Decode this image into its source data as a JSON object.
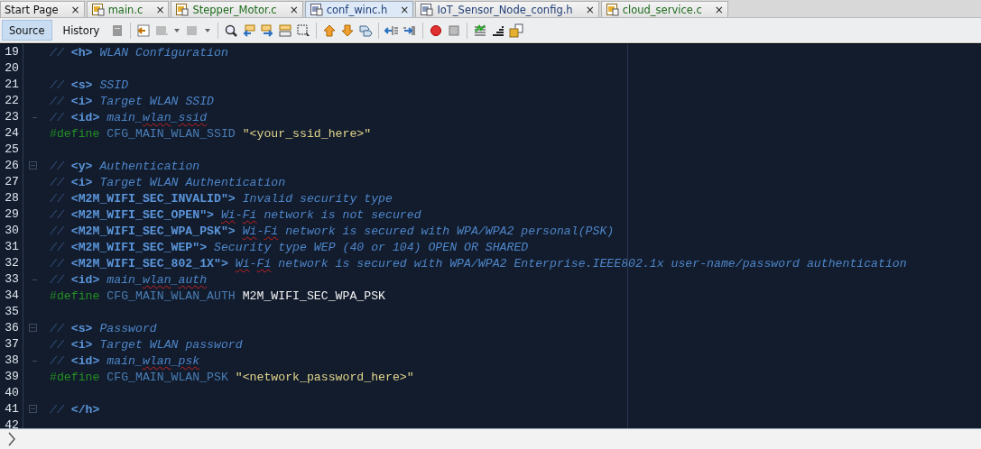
{
  "tabs": [
    {
      "label": "Start Page",
      "kind": "page",
      "selected": false
    },
    {
      "label": "main.c",
      "kind": "c",
      "selected": false
    },
    {
      "label": "Stepper_Motor.c",
      "kind": "c",
      "selected": false
    },
    {
      "label": "conf_winc.h",
      "kind": "h",
      "selected": true
    },
    {
      "label": "IoT_Sensor_Node_config.h",
      "kind": "h",
      "selected": false
    },
    {
      "label": "cloud_service.c",
      "kind": "c",
      "selected": false
    }
  ],
  "tab_close": "×",
  "view_buttons": [
    {
      "label": "Source",
      "selected": true
    },
    {
      "label": "History",
      "selected": false
    }
  ],
  "editor": {
    "lines": [
      {
        "number": "19",
        "fold_start": false,
        "fold_end": false,
        "tokens": [
          {
            "kind": "slashes",
            "text": "// "
          },
          {
            "kind": "tag",
            "text": "<h>"
          },
          {
            "kind": "comment",
            "text": " WLAN Configuration"
          }
        ]
      },
      {
        "number": "20",
        "fold_start": false,
        "fold_end": false
      },
      {
        "number": "21",
        "fold_start": false,
        "fold_end": false,
        "tokens": [
          {
            "kind": "slashes",
            "text": "// "
          },
          {
            "kind": "tag",
            "text": "<s>"
          },
          {
            "kind": "comment",
            "text": " SSID"
          }
        ]
      },
      {
        "number": "22",
        "fold_start": false,
        "fold_end": false,
        "tokens": [
          {
            "kind": "slashes",
            "text": "// "
          },
          {
            "kind": "tag",
            "text": "<i>"
          },
          {
            "kind": "comment",
            "text": " Target WLAN SSID"
          }
        ]
      },
      {
        "number": "23",
        "fold_start": false,
        "fold_end": true,
        "tokens": [
          {
            "kind": "slashes",
            "text": "// "
          },
          {
            "kind": "tag",
            "text": "<id>"
          },
          {
            "kind": "comment",
            "text": " main_"
          },
          {
            "kind": "typo",
            "text": "wlan"
          },
          {
            "kind": "comment",
            "text": "_"
          },
          {
            "kind": "typo",
            "text": "ssid"
          }
        ]
      },
      {
        "number": "24",
        "fold_start": false,
        "fold_end": false,
        "tokens": [
          {
            "kind": "keyword",
            "text": "#define"
          },
          {
            "kind": "macro",
            "text": " CFG_MAIN_WLAN_SSID "
          },
          {
            "kind": "string",
            "text": "\"<your_ssid_here>\""
          }
        ]
      },
      {
        "number": "25",
        "fold_start": false,
        "fold_end": false
      },
      {
        "number": "26",
        "fold_start": true,
        "fold_end": false,
        "tokens": [
          {
            "kind": "slashes",
            "text": "// "
          },
          {
            "kind": "tag",
            "text": "<y>"
          },
          {
            "kind": "comment",
            "text": " Authentication"
          }
        ]
      },
      {
        "number": "27",
        "fold_start": false,
        "fold_end": false,
        "tokens": [
          {
            "kind": "slashes",
            "text": "// "
          },
          {
            "kind": "tag",
            "text": "<i>"
          },
          {
            "kind": "comment",
            "text": " Target WLAN Authentication"
          }
        ]
      },
      {
        "number": "28",
        "fold_start": false,
        "fold_end": false,
        "tokens": [
          {
            "kind": "slashes",
            "text": "// "
          },
          {
            "kind": "tag",
            "text": "<M2M_WIFI_SEC_INVALID\">"
          },
          {
            "kind": "comment",
            "text": " Invalid security type"
          }
        ]
      },
      {
        "number": "29",
        "fold_start": false,
        "fold_end": false,
        "tokens": [
          {
            "kind": "slashes",
            "text": "// "
          },
          {
            "kind": "tag",
            "text": "<M2M_WIFI_SEC_OPEN\"> "
          },
          {
            "kind": "typo",
            "text": "Wi"
          },
          {
            "kind": "comment",
            "text": "-"
          },
          {
            "kind": "typo",
            "text": "Fi"
          },
          {
            "kind": "comment",
            "text": " network is not secured"
          }
        ]
      },
      {
        "number": "30",
        "fold_start": false,
        "fold_end": false,
        "tokens": [
          {
            "kind": "slashes",
            "text": "// "
          },
          {
            "kind": "tag",
            "text": "<M2M_WIFI_SEC_WPA_PSK\"> "
          },
          {
            "kind": "typo",
            "text": "Wi"
          },
          {
            "kind": "comment",
            "text": "-"
          },
          {
            "kind": "typo",
            "text": "Fi"
          },
          {
            "kind": "comment",
            "text": " network is secured with WPA/WPA2 personal(PSK)"
          }
        ]
      },
      {
        "number": "31",
        "fold_start": false,
        "fold_end": false,
        "tokens": [
          {
            "kind": "slashes",
            "text": "// "
          },
          {
            "kind": "tag",
            "text": "<M2M_WIFI_SEC_WEP\">"
          },
          {
            "kind": "comment",
            "text": " Security type WEP (40 or 104) OPEN OR SHARED"
          }
        ]
      },
      {
        "number": "32",
        "fold_start": false,
        "fold_end": false,
        "tokens": [
          {
            "kind": "slashes",
            "text": "// "
          },
          {
            "kind": "tag",
            "text": "<M2M_WIFI_SEC_802_1X\"> "
          },
          {
            "kind": "typo",
            "text": "Wi"
          },
          {
            "kind": "comment",
            "text": "-"
          },
          {
            "kind": "typo",
            "text": "Fi"
          },
          {
            "kind": "comment",
            "text": " network is secured with WPA/WPA2 Enterprise.IEEE802.1x user-name/password authentication"
          }
        ]
      },
      {
        "number": "33",
        "fold_start": false,
        "fold_end": true,
        "tokens": [
          {
            "kind": "slashes",
            "text": "// "
          },
          {
            "kind": "tag",
            "text": "<id>"
          },
          {
            "kind": "comment",
            "text": " main_"
          },
          {
            "kind": "typo",
            "text": "wlan"
          },
          {
            "kind": "comment",
            "text": "_"
          },
          {
            "kind": "typo",
            "text": "auth"
          }
        ]
      },
      {
        "number": "34",
        "fold_start": false,
        "fold_end": false,
        "tokens": [
          {
            "kind": "keyword",
            "text": "#define"
          },
          {
            "kind": "macro",
            "text": " CFG_MAIN_WLAN_AUTH "
          },
          {
            "kind": "value",
            "text": "M2M_WIFI_SEC_WPA_PSK"
          }
        ]
      },
      {
        "number": "35",
        "fold_start": false,
        "fold_end": false
      },
      {
        "number": "36",
        "fold_start": true,
        "fold_end": false,
        "tokens": [
          {
            "kind": "slashes",
            "text": "// "
          },
          {
            "kind": "tag",
            "text": "<s>"
          },
          {
            "kind": "comment",
            "text": " Password"
          }
        ]
      },
      {
        "number": "37",
        "fold_start": false,
        "fold_end": false,
        "tokens": [
          {
            "kind": "slashes",
            "text": "// "
          },
          {
            "kind": "tag",
            "text": "<i>"
          },
          {
            "kind": "comment",
            "text": " Target WLAN password"
          }
        ]
      },
      {
        "number": "38",
        "fold_start": false,
        "fold_end": true,
        "tokens": [
          {
            "kind": "slashes",
            "text": "// "
          },
          {
            "kind": "tag",
            "text": "<id>"
          },
          {
            "kind": "comment",
            "text": " main_"
          },
          {
            "kind": "typo",
            "text": "wlan"
          },
          {
            "kind": "comment",
            "text": "_"
          },
          {
            "kind": "typo",
            "text": "psk"
          }
        ]
      },
      {
        "number": "39",
        "fold_start": false,
        "fold_end": false,
        "tokens": [
          {
            "kind": "keyword",
            "text": "#define"
          },
          {
            "kind": "macro",
            "text": " CFG_MAIN_WLAN_PSK "
          },
          {
            "kind": "string",
            "text": "\"<network_password_here>\""
          }
        ]
      },
      {
        "number": "40",
        "fold_start": false,
        "fold_end": false
      },
      {
        "number": "41",
        "fold_start": true,
        "fold_end": false,
        "tokens": [
          {
            "kind": "slashes",
            "text": "// "
          },
          {
            "kind": "tag",
            "text": "</h>"
          }
        ]
      },
      {
        "number": "42",
        "fold_start": false,
        "fold_end": false
      }
    ]
  }
}
